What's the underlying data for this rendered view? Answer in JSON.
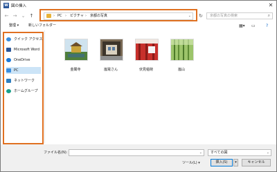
{
  "window": {
    "title": "図の挿入",
    "app_icon": "W"
  },
  "nav": {
    "back": "←",
    "forward": "→",
    "dropdown": "⌄",
    "up": "↑"
  },
  "address": {
    "crumbs": [
      "PC",
      "ピクチャ",
      "京都の写真"
    ],
    "separator": "›"
  },
  "search": {
    "placeholder": "京都の写真の検索"
  },
  "toolbar": {
    "organize": "整理 ▾",
    "new_folder": "新しいフォルダー"
  },
  "sidebar": {
    "items": [
      {
        "label": "クイック アクセス",
        "icon": "star-icon",
        "color": "#3b8ede"
      },
      {
        "label": "Microsoft Word",
        "icon": "word-icon",
        "color": "#2b579a"
      },
      {
        "label": "OneDrive",
        "icon": "cloud-icon",
        "color": "#1e7ad8"
      },
      {
        "label": "PC",
        "icon": "pc-icon",
        "color": "#3b8ede",
        "selected": true
      },
      {
        "label": "ネットワーク",
        "icon": "network-icon",
        "color": "#2f7fc0"
      },
      {
        "label": "ホームグループ",
        "icon": "homegroup-icon",
        "color": "#1aa08b"
      }
    ]
  },
  "files": [
    {
      "name": "金閣寺"
    },
    {
      "name": "嵐電さん"
    },
    {
      "name": "伏見稲荷"
    },
    {
      "name": "嵐山"
    }
  ],
  "bottom": {
    "filename_label": "ファイル名(N):",
    "filename_value": "",
    "filetype": "すべての図",
    "tools": "ツール(L) ▾",
    "insert": "挿入(S)",
    "cancel": "キャンセル"
  },
  "colors": {
    "highlight": "#e07020",
    "selection": "#cce4f7",
    "accent": "#0078d7"
  }
}
